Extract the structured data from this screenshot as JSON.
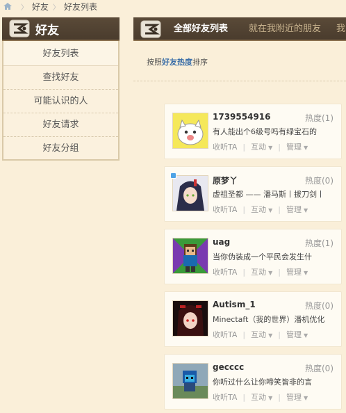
{
  "breadcrumb": [
    "好友",
    "好友列表"
  ],
  "sidebar": {
    "title": "好友",
    "items": [
      {
        "label": "好友列表"
      },
      {
        "label": "查找好友"
      },
      {
        "label": "可能认识的人"
      },
      {
        "label": "好友请求"
      },
      {
        "label": "好友分组"
      }
    ]
  },
  "tabs": [
    {
      "label": "全部好友列表"
    },
    {
      "label": "就在我附近的朋友"
    },
    {
      "label": "我"
    }
  ],
  "sort": {
    "prefix": "按照",
    "highlight": "好友热度",
    "suffix": "排序"
  },
  "actions": {
    "listen": "收听TA",
    "interact": "互动",
    "manage": "管理"
  },
  "friends": [
    {
      "name": "1739554916",
      "heat": "热度(1)",
      "status": "有人能出个6级号吗有绿宝石的",
      "online": false
    },
    {
      "name": "原梦丫",
      "heat": "热度(0)",
      "status": "虚祖圣都 —— 潘马斯丨拔刀剑丨",
      "online": true
    },
    {
      "name": "uag",
      "heat": "热度(1)",
      "status": "当你伪装成一个平民会发生什",
      "online": false
    },
    {
      "name": "Autism_1",
      "heat": "热度(0)",
      "status": "Minectaft（我的世界）潘机优化",
      "online": false
    },
    {
      "name": "gecccc",
      "heat": "热度(0)",
      "status": "你听过什么让你啼笑皆非的言",
      "online": false
    }
  ],
  "colors": {
    "header_bg": "#4f4030",
    "page_bg": "#faefd9",
    "accent_link": "#3a6ea8"
  }
}
